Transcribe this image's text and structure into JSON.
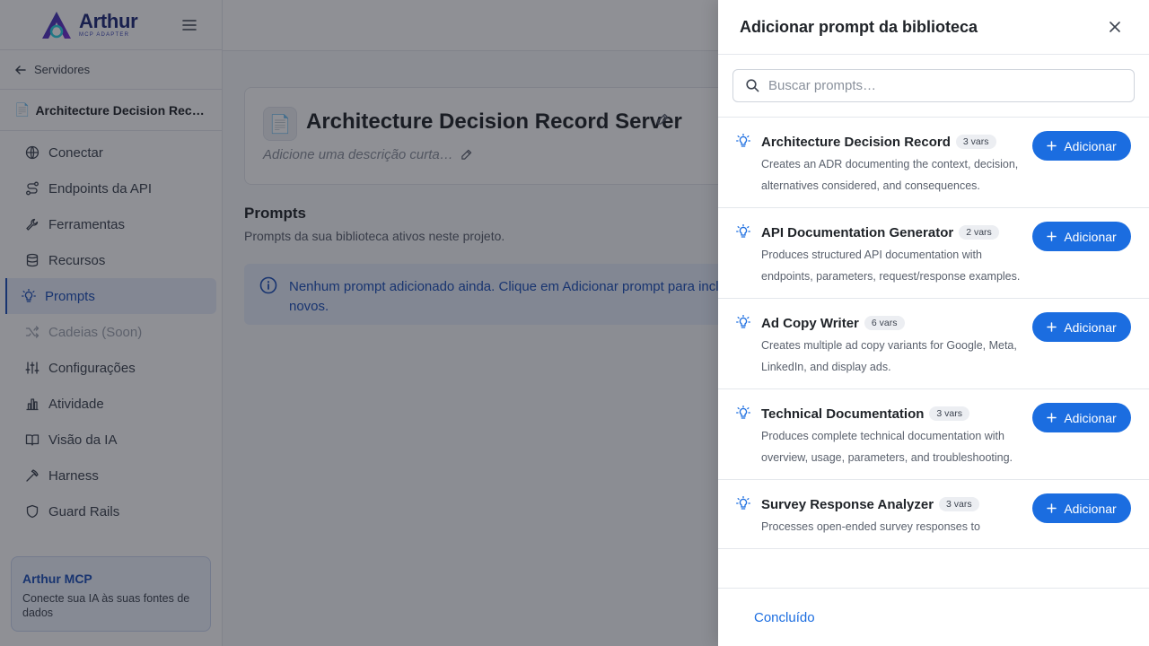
{
  "brand": {
    "name": "Arthur",
    "subtitle": "MCP ADAPTER"
  },
  "sidebar": {
    "back_label": "Servidores",
    "server_name": "Architecture Decision Recor…",
    "server_emoji": "📄",
    "items": [
      {
        "label": "Conectar",
        "icon": "globe-icon"
      },
      {
        "label": "Endpoints da API",
        "icon": "route-icon"
      },
      {
        "label": "Ferramentas",
        "icon": "wrench-icon"
      },
      {
        "label": "Recursos",
        "icon": "database-icon"
      },
      {
        "label": "Prompts",
        "icon": "lightbulb-icon",
        "active": true
      },
      {
        "label": "Cadeias (Soon)",
        "icon": "shuffle-icon",
        "disabled": true
      },
      {
        "label": "Configurações",
        "icon": "sliders-icon"
      },
      {
        "label": "Atividade",
        "icon": "bar-chart-icon"
      },
      {
        "label": "Visão da IA",
        "icon": "book-icon"
      },
      {
        "label": "Harness",
        "icon": "pickaxe-icon"
      },
      {
        "label": "Guard Rails",
        "icon": "shield-icon"
      }
    ],
    "promo": {
      "title": "Arthur MCP",
      "text": "Conecte sua IA às suas fontes de dados"
    }
  },
  "main": {
    "card": {
      "emoji": "📄",
      "title": "Architecture Decision Record Server",
      "description_placeholder": "Adicione uma descrição curta…"
    },
    "section_title": "Prompts",
    "section_subtitle": "Prompts da sua biblioteca ativos neste projeto.",
    "empty_message": "Nenhum prompt adicionado ainda. Clique em Adicionar prompt para incluir novos."
  },
  "drawer": {
    "title": "Adicionar prompt da biblioteca",
    "search_placeholder": "Buscar prompts…",
    "add_label": "Adicionar",
    "done_label": "Concluído",
    "prompts": [
      {
        "name": "Architecture Decision Record",
        "vars": "3 vars",
        "description": "Creates an ADR documenting the context, decision, alternatives considered, and consequences."
      },
      {
        "name": "API Documentation Generator",
        "vars": "2 vars",
        "description": "Produces structured API documentation with endpoints, parameters, request/response examples."
      },
      {
        "name": "Ad Copy Writer",
        "vars": "6 vars",
        "description": "Creates multiple ad copy variants for Google, Meta, LinkedIn, and display ads."
      },
      {
        "name": "Technical Documentation",
        "vars": "3 vars",
        "description": "Produces complete technical documentation with overview, usage, parameters, and troubleshooting."
      },
      {
        "name": "Survey Response Analyzer",
        "vars": "3 vars",
        "description": "Processes open-ended survey responses to"
      }
    ]
  },
  "colors": {
    "accent": "#1b6de0",
    "active_nav": "#1b4fb8",
    "info_bg": "#e6eefc"
  }
}
